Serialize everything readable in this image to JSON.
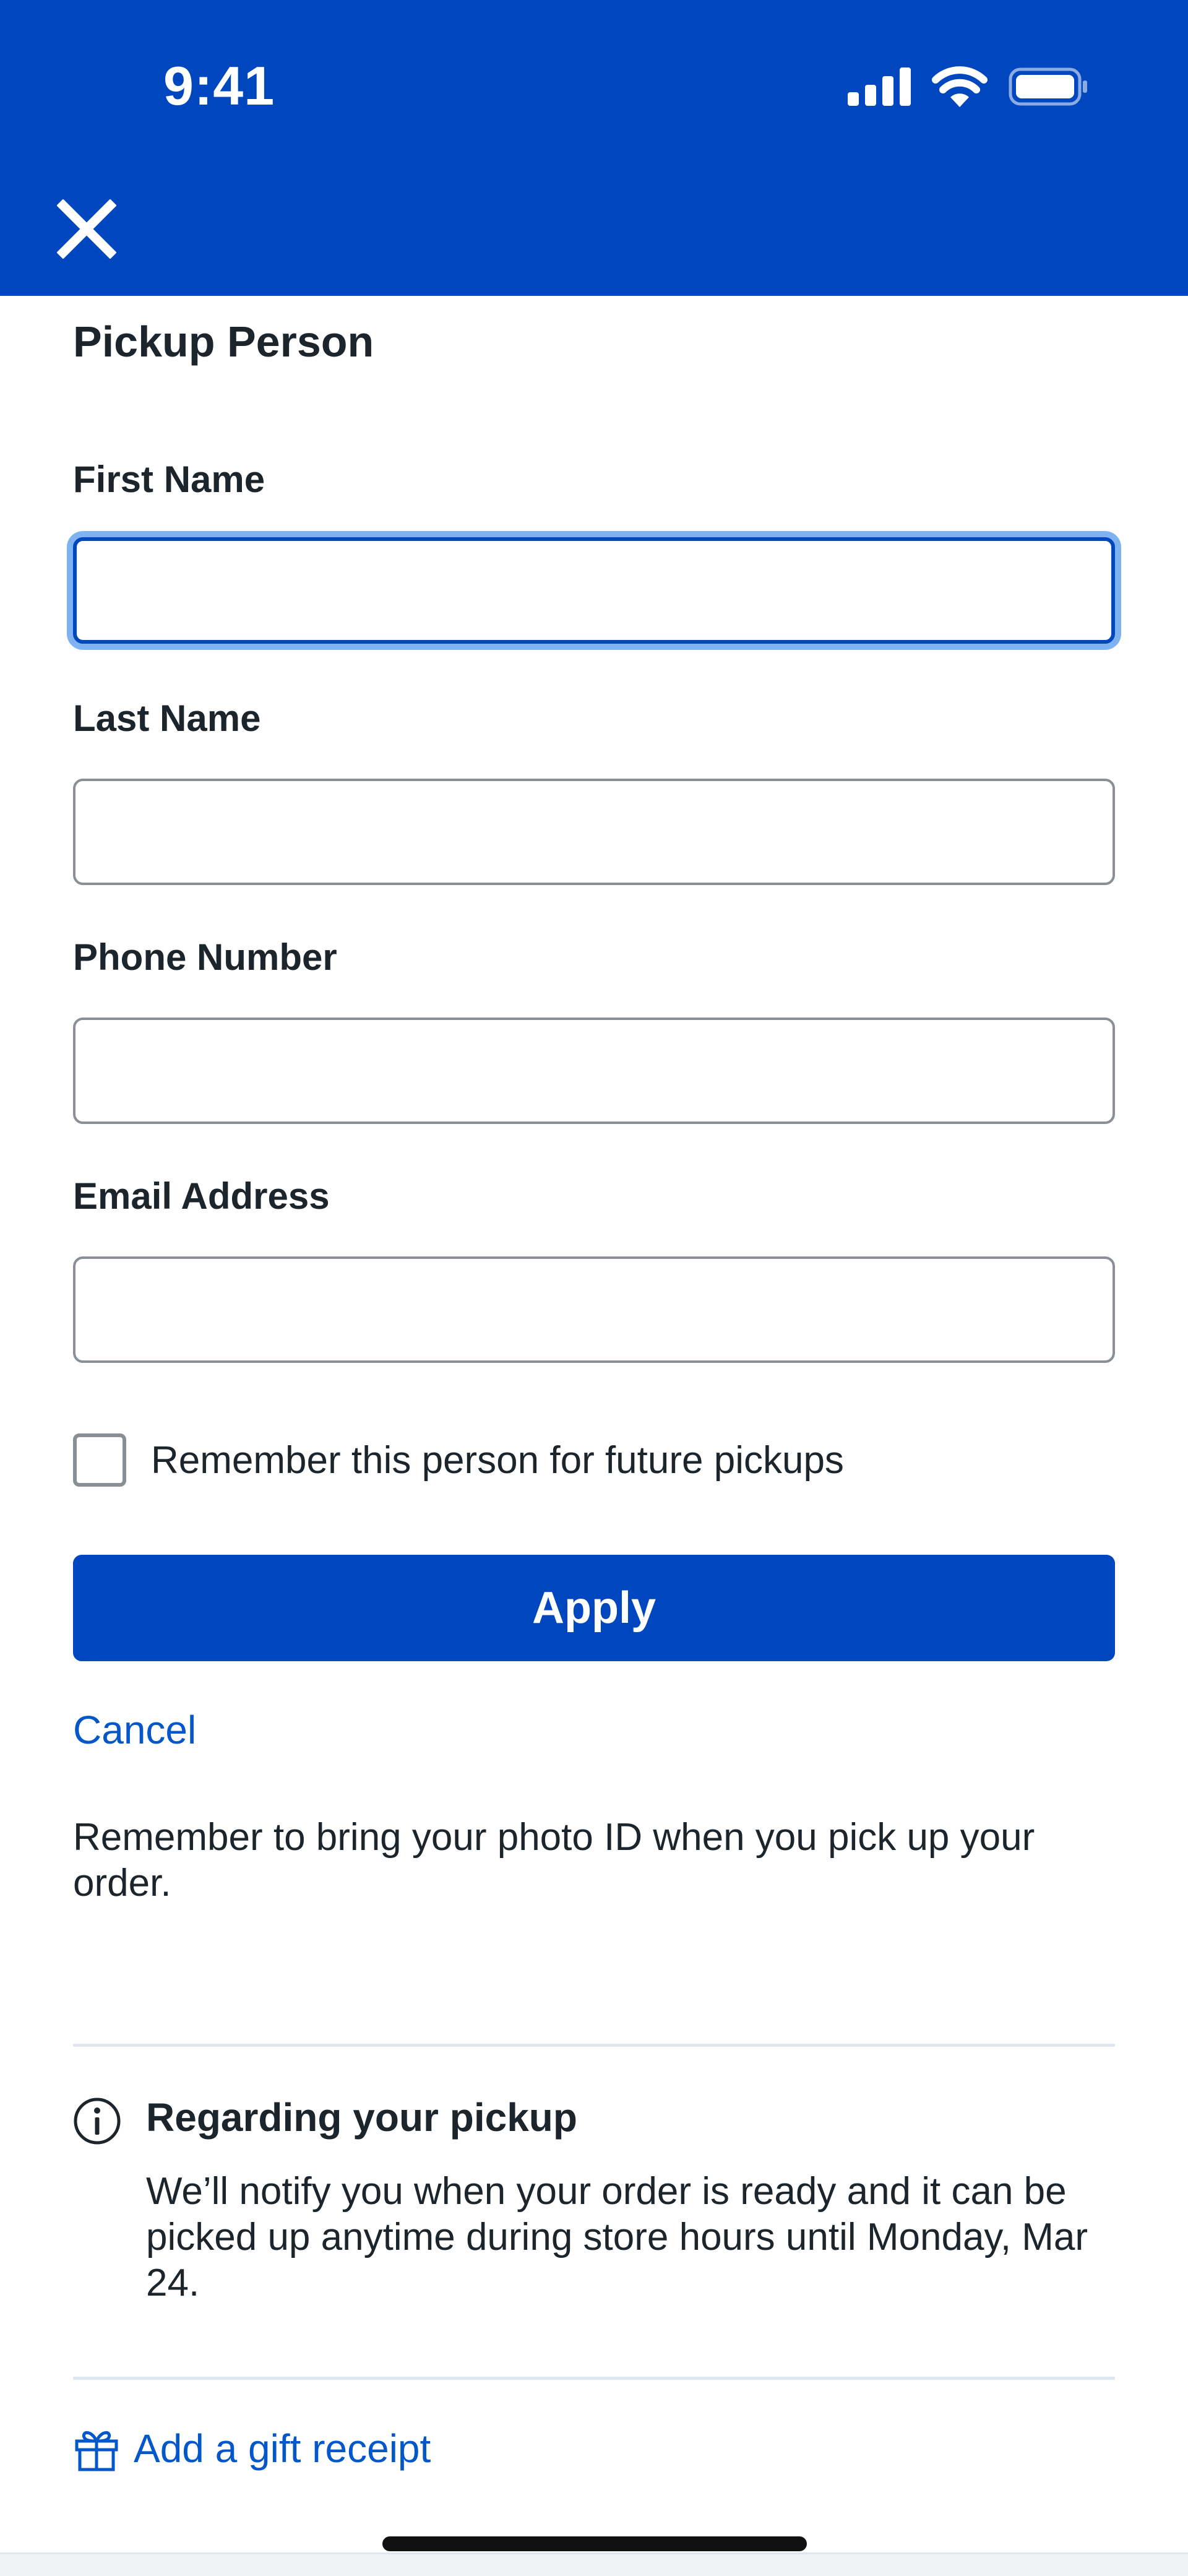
{
  "status_bar": {
    "time": "9:41",
    "icons": [
      "signal-icon",
      "wifi-icon",
      "battery-icon"
    ]
  },
  "header": {
    "close_icon": "close-icon"
  },
  "form": {
    "title": "Pickup Person",
    "first_name": {
      "label": "First Name",
      "value": "",
      "placeholder": ""
    },
    "last_name": {
      "label": "Last Name",
      "value": "",
      "placeholder": ""
    },
    "phone": {
      "label": "Phone Number",
      "value": "",
      "placeholder": ""
    },
    "email": {
      "label": "Email Address",
      "value": "",
      "placeholder": ""
    },
    "remember_label": "Remember this person for future pickups",
    "remember_checked": false,
    "apply_label": "Apply",
    "cancel_label": "Cancel",
    "note": "Remember to bring your photo ID when you pick up your order."
  },
  "pickup_info": {
    "title": "Regarding your pickup",
    "body": "We’ll notify you when your order is ready and it can be picked up anytime during store hours until Monday, Mar 24."
  },
  "gift": {
    "label": "Add a gift receipt"
  },
  "colors": {
    "brand_blue": "#0046be",
    "link_blue": "#0457c8",
    "focus_ring": "#7fb2f0",
    "text": "#1d252c"
  }
}
